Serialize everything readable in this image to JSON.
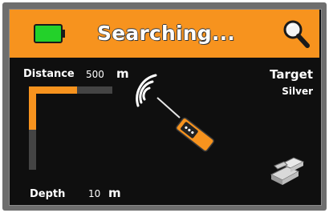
{
  "header": {
    "status_title": "Searching...",
    "battery_icon": "battery-full-icon",
    "search_icon": "magnifier-icon",
    "accent_color": "#f7931e"
  },
  "distance": {
    "label": "Distance",
    "value": "500",
    "unit": "m",
    "level": 0.58
  },
  "depth": {
    "label": "Depth",
    "value": "10",
    "unit": "m",
    "level": 0.52
  },
  "target": {
    "label": "Target",
    "value": "Silver",
    "icon": "silver-bars-icon"
  },
  "detector": {
    "icon": "detector-signal-icon"
  }
}
